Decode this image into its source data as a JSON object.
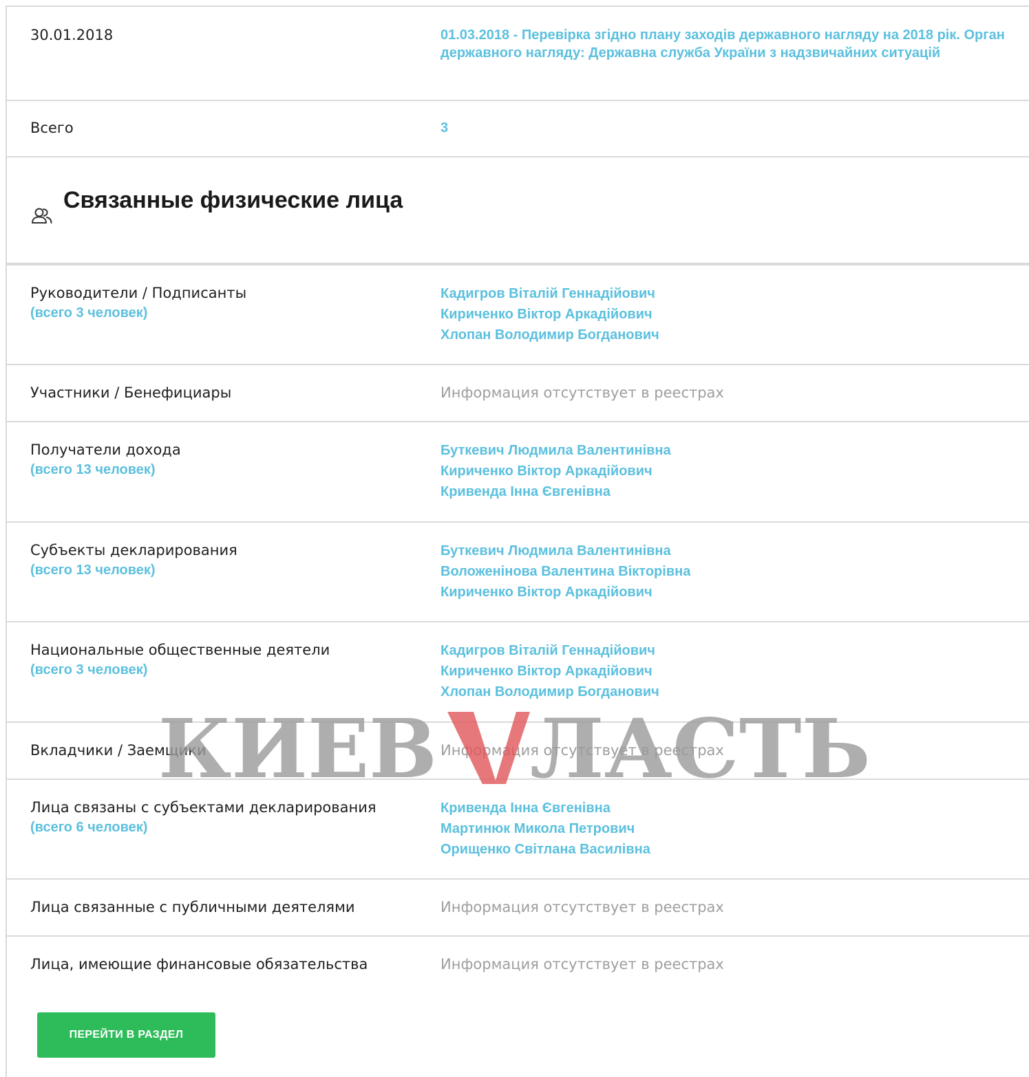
{
  "check_row": {
    "date": "30.01.2018",
    "description": "01.03.2018 - Перевірка згідно плану заходів державного нагляду на 2018 рік. Орган державного нагляду: Державна служба України з надзвичайних ситуацій"
  },
  "total_row": {
    "label": "Всего",
    "value": "3"
  },
  "section": {
    "title": "Связанные физические лица",
    "icon": "people-icon"
  },
  "rows": {
    "managers": {
      "label": "Руководители / Подписанты",
      "count": "(всего 3 человек)",
      "people": [
        "Кадигров Віталій Геннадійович",
        "Кириченко Віктор Аркадійович",
        "Хлопан Володимир Богданович"
      ]
    },
    "participants": {
      "label": "Участники / Бенефициары",
      "empty": "Информация отсутствует в реестрах"
    },
    "income": {
      "label": "Получатели дохода",
      "count": "(всего 13 человек)",
      "people": [
        "Буткевич Людмила Валентинівна",
        "Кириченко Віктор Аркадійович",
        "Кривенда Інна Євгенівна"
      ]
    },
    "declarants": {
      "label": "Субъекты декларирования",
      "count": "(всего 13 человек)",
      "people": [
        "Буткевич Людмила Валентинівна",
        "Воложенінова Валентина Вікторівна",
        "Кириченко Віктор Аркадійович"
      ]
    },
    "public_figures": {
      "label": "Национальные общественные деятели",
      "count": "(всего 3 человек)",
      "people": [
        "Кадигров Віталій Геннадійович",
        "Кириченко Віктор Аркадійович",
        "Хлопан Володимир Богданович"
      ]
    },
    "depositors": {
      "label": "Вкладчики / Заемщики",
      "empty": "Информация отсутствует в реестрах"
    },
    "related_declarants": {
      "label": "Лица связаны с субъектами декларирования",
      "count": "(всего 6 человек)",
      "people": [
        "Кривенда Інна Євгенівна",
        "Мартинюк Микола Петрович",
        "Орищенко Світлана Василівна"
      ]
    },
    "related_public": {
      "label": "Лица связанные с публичными деятелями",
      "empty": "Информация отсутствует в реестрах"
    },
    "financial": {
      "label": "Лица, имеющие финансовые обязательства",
      "empty": "Информация отсутствует в реестрах"
    }
  },
  "button": {
    "label": "ПЕРЕЙТИ В РАЗДЕЛ"
  },
  "watermark": {
    "text_left": "КИЕВ",
    "text_right": "ЛАСТЬ",
    "colors": {
      "gray": "#9a9a9a",
      "red": "#e0565a"
    }
  },
  "colors": {
    "link": "#5bc0de",
    "muted": "#9e9e9e",
    "button": "#2ebc5a",
    "divider": "#dadada"
  }
}
